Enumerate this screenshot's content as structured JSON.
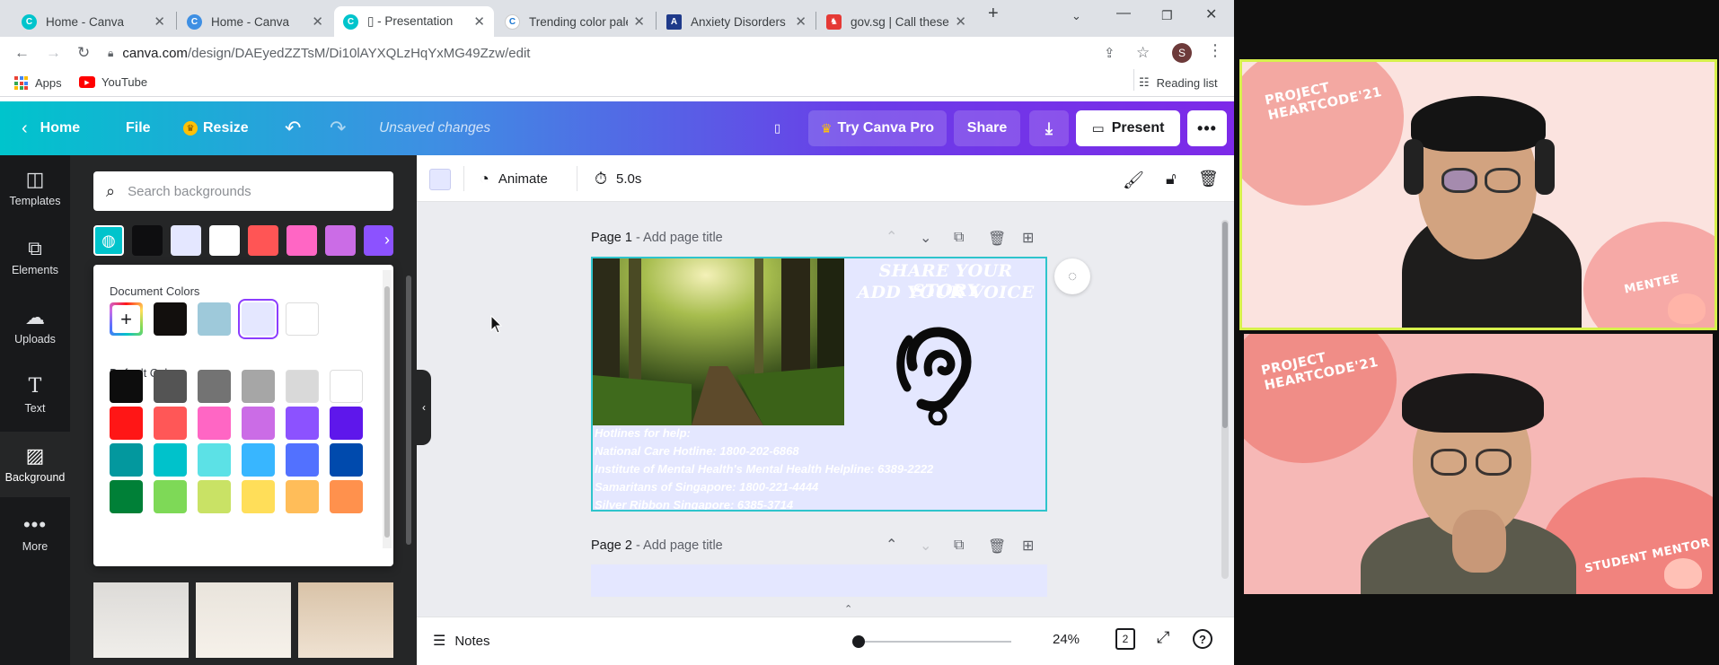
{
  "browser": {
    "tabs": [
      {
        "title": "Home - Canva",
        "active": false
      },
      {
        "title": "Home - Canva",
        "active": false
      },
      {
        "title": "▯ - Presentation",
        "active": true
      },
      {
        "title": "Trending color pale",
        "active": false
      },
      {
        "title": "Anxiety Disorders a",
        "active": false
      },
      {
        "title": "gov.sg | Call these t",
        "active": false
      }
    ],
    "url_domain": "canva.com",
    "url_path": "/design/DAEyedZZTsM/Di10lAYXQLzHqYxMG49Zzw/edit",
    "profile_initial": "S",
    "bookmarks": {
      "apps": "Apps",
      "youtube": "YouTube",
      "reading_list": "Reading list"
    }
  },
  "canva_header": {
    "home": "Home",
    "file": "File",
    "resize": "Resize",
    "status": "Unsaved changes",
    "title_glyph": "▯",
    "try_pro": "Try Canva Pro",
    "share": "Share",
    "present": "Present"
  },
  "rail": [
    {
      "label": "Templates",
      "icon": "templates-icon"
    },
    {
      "label": "Elements",
      "icon": "elements-icon"
    },
    {
      "label": "Uploads",
      "icon": "uploads-icon"
    },
    {
      "label": "Text",
      "icon": "text-icon"
    },
    {
      "label": "Background",
      "icon": "background-icon",
      "active": true
    },
    {
      "label": "More",
      "icon": "more-icon"
    }
  ],
  "panel": {
    "search_placeholder": "Search backgrounds",
    "swatches": [
      "#0e0e10",
      "#e4e7ff",
      "#ffffff",
      "#ff5555",
      "#ff66c4",
      "#cb6ce6",
      "#8c52ff"
    ],
    "popup": {
      "document_colors_label": "Document Colors",
      "document_colors": [
        "#120f0d",
        "#9ec9da",
        "#e4e7ff",
        "#ffffff"
      ],
      "default_colors_label": "Default Colors",
      "default_colors": [
        [
          "#0d0d0d",
          "#545454",
          "#737373",
          "#a6a6a6",
          "#d9d9d9",
          "#ffffff"
        ],
        [
          "#ff1616",
          "#ff5757",
          "#ff66c4",
          "#cb6ce6",
          "#8c52ff",
          "#5e17eb"
        ],
        [
          "#03989e",
          "#00c2cb",
          "#5ce1e6",
          "#38b6ff",
          "#5271ff",
          "#004aad"
        ],
        [
          "#008037",
          "#7ed957",
          "#c9e265",
          "#ffde59",
          "#ffbd59",
          "#ff914d"
        ]
      ]
    }
  },
  "editor": {
    "duration": "5.0s",
    "animate": "Animate",
    "page1_label": "Page 1",
    "page2_label": "Page 2",
    "add_title": "- Add page title",
    "slide": {
      "heading_line1": "SHARE YOUR STORY",
      "heading_line2": "ADD YOUR VOICE",
      "hotlines": [
        "Hotlines for help:",
        "National Care Hotline: 1800-202-6868",
        "Institute of Mental Health's Mental Health Helpline: 6389-2222",
        "Samaritans of Singapore: 1800-221-4444",
        "Silver Ribbon Singapore: 6385-3714"
      ]
    },
    "notes": "Notes",
    "zoom": "24%",
    "page_count": "2",
    "help": "?"
  },
  "video": {
    "tile1": {
      "title_line1": "PROJECT",
      "title_line2": "HEARTCODE'21",
      "tag": "MENTEE"
    },
    "tile2": {
      "title_line1": "PROJECT",
      "title_line2": "HEARTCODE'21",
      "tag": "STUDENT MENTOR"
    }
  },
  "colors": {
    "accent_teal": "#2ec4cc",
    "accent_purple": "#7d2ae8",
    "slide_bg": "#e4e7ff"
  }
}
